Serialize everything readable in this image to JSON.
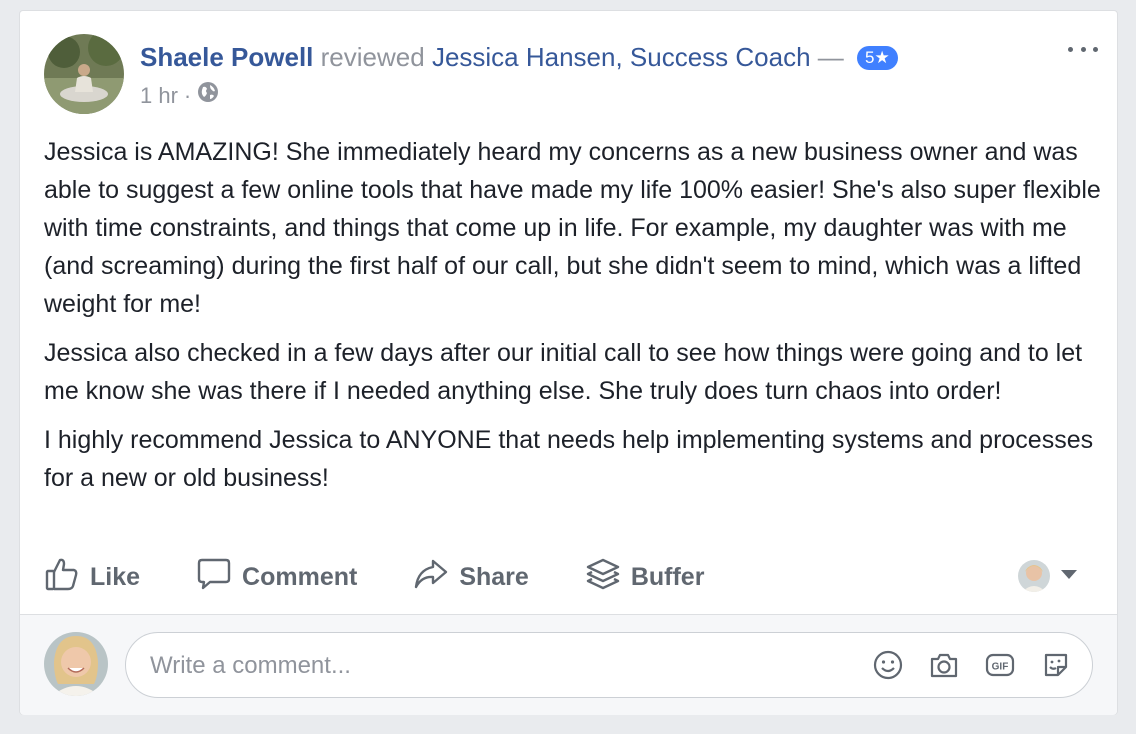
{
  "post": {
    "author": "Shaele Powell",
    "verb": "reviewed",
    "page": "Jessica Hansen, Success Coach",
    "dash": "—",
    "rating": "5★",
    "time": "1 hr",
    "meta_dot": "·",
    "audience_icon": "globe-icon",
    "menu_icon": "more-options-icon",
    "paragraphs": [
      "Jessica is AMAZING! She immediately heard my concerns as a new business owner and was able to suggest a few online tools that have made my life 100% easier! She's also super flexible with time constraints, and things that come up in life. For example, my daughter was with me (and screaming) during the first half of our call, but she didn't seem to mind, which was a lifted weight for me!",
      "Jessica also checked in a few days after our initial call to see how things were going and to let me know she was there if I needed anything else. She truly does turn chaos into order!",
      "I highly recommend Jessica to ANYONE that needs help implementing systems and processes for a new or old business!"
    ]
  },
  "actions": {
    "like": "Like",
    "comment": "Comment",
    "share": "Share",
    "buffer": "Buffer"
  },
  "comment_box": {
    "placeholder": "Write a comment...",
    "icons": [
      "emoji-icon",
      "camera-icon",
      "gif-icon",
      "sticker-icon"
    ]
  },
  "colors": {
    "link": "#365899",
    "muted": "#90949c",
    "rating_badge": "#4080ff",
    "action_text": "#606770"
  }
}
